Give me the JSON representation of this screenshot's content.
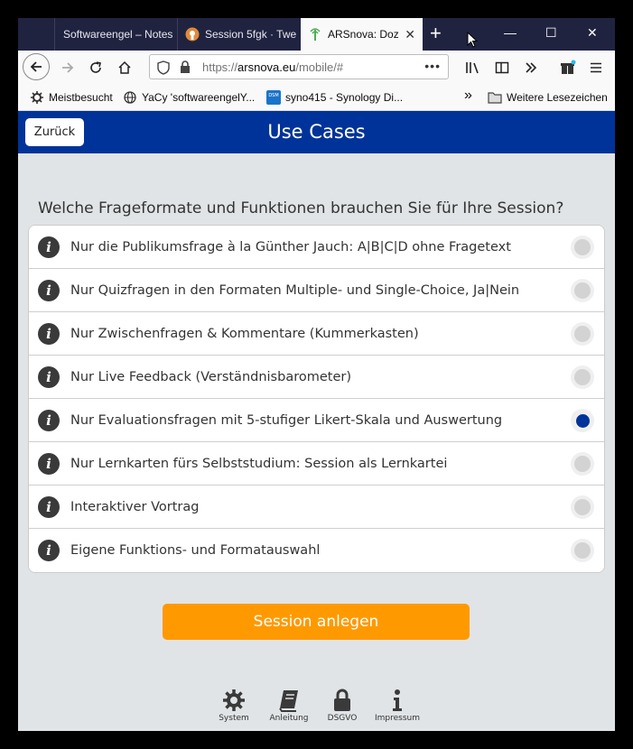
{
  "browser": {
    "tabs": [
      {
        "label": "Softwareengel – Notes"
      },
      {
        "label": "Session 5fgk · Twe"
      },
      {
        "label": "ARSnova: Doze"
      }
    ],
    "url_prefix": "https://",
    "url_host": "arsnova.eu",
    "url_path": "/mobile/#",
    "url_more": "•••",
    "bookmarks": [
      {
        "label": "Meistbesucht"
      },
      {
        "label": "YaCy 'softwareengelY..."
      },
      {
        "label": "syno415 - Synology Di..."
      }
    ],
    "bookmarks_more": "»",
    "bookmarks_folder": "Weitere Lesezeichen",
    "new_tab": "+",
    "minimize": "—",
    "maximize": "☐",
    "close": "✕"
  },
  "page": {
    "back_label": "Zurück",
    "title": "Use Cases",
    "question": "Welche Frageformate und Funktionen brauchen Sie für Ihre Session?",
    "info_glyph": "i",
    "options": [
      {
        "label": "Nur die Publikumsfrage à la Günther Jauch: A|B|C|D ohne Fragetext",
        "selected": false
      },
      {
        "label": "Nur Quizfragen in den Formaten Multiple- und Single-Choice, Ja|Nein",
        "selected": false
      },
      {
        "label": "Nur Zwischenfragen & Kommentare (Kummerkasten)",
        "selected": false
      },
      {
        "label": "Nur Live Feedback (Verständnisbarometer)",
        "selected": false
      },
      {
        "label": "Nur Evaluationsfragen mit 5-stufiger Likert-Skala und Auswertung",
        "selected": true
      },
      {
        "label": "Nur Lernkarten fürs Selbststudium: Session als Lernkartei",
        "selected": false
      },
      {
        "label": "Interaktiver Vortrag",
        "selected": false
      },
      {
        "label": "Eigene Funktions- und Formatauswahl",
        "selected": false
      }
    ],
    "create_label": "Session anlegen",
    "footer": [
      {
        "label": "System",
        "icon": "gear-icon"
      },
      {
        "label": "Anleitung",
        "icon": "book-icon"
      },
      {
        "label": "DSGVO",
        "icon": "lock-icon"
      },
      {
        "label": "Impressum",
        "icon": "info-icon"
      }
    ]
  },
  "colors": {
    "header": "#003399",
    "accent": "#ff9900",
    "selected_radio": "#003399",
    "page_bg": "#e0e4e6"
  }
}
